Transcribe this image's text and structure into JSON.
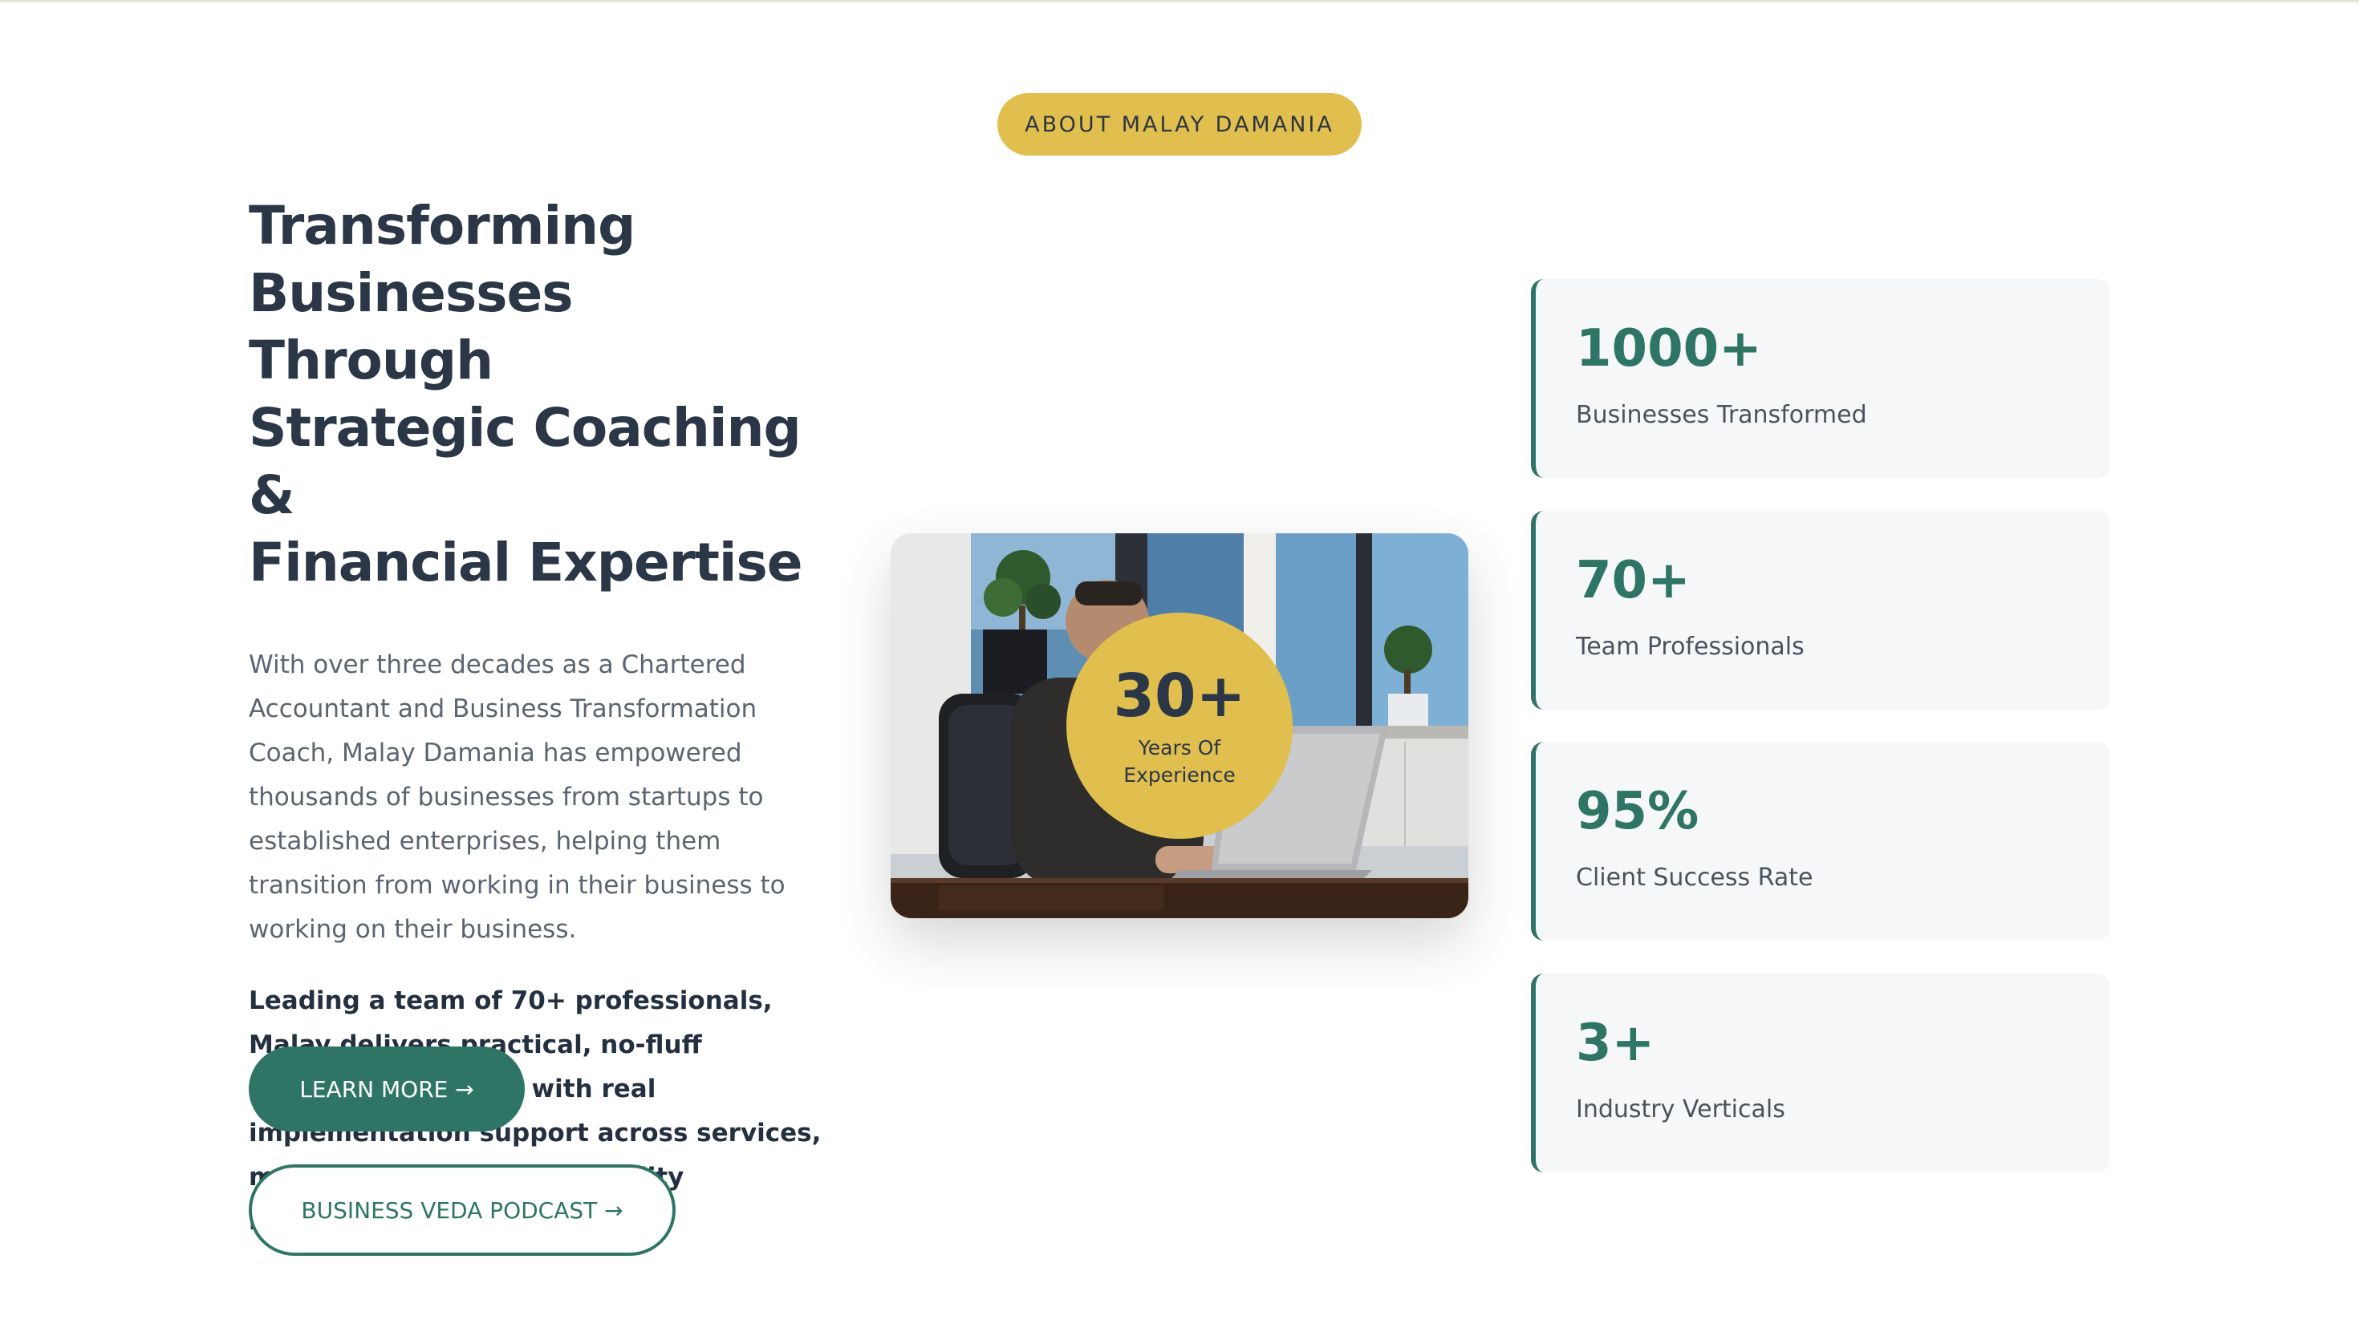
{
  "badge": {
    "label": "ABOUT MALAY DAMANIA"
  },
  "about": {
    "headline_lines": [
      "Transforming",
      "Businesses Through",
      "Strategic Coaching &",
      "Financial Expertise"
    ],
    "paragraph": "With over three decades as a Chartered Accountant and Business Transformation Coach, Malay Damania has empowered thousands of businesses from startups to established enterprises, helping them transition from working in their business to working on their business.",
    "paragraph_strong": "Leading a team of 70+ professionals, Malay delivers practical, no-fluff business strategies with real implementation support across services, manufacturing, and hospitality industries."
  },
  "buttons": {
    "learn_more": "LEARN MORE →",
    "podcast": "BUSINESS VEDA PODCAST →"
  },
  "experience": {
    "number": "30+",
    "label_line1": "Years Of",
    "label_line2": "Experience"
  },
  "stats": [
    {
      "number": "1000+",
      "label": "Businesses Transformed"
    },
    {
      "number": "70+",
      "label": "Team Professionals"
    },
    {
      "number": "95%",
      "label": "Client Success Rate"
    },
    {
      "number": "3+",
      "label": "Industry Verticals"
    }
  ],
  "colors": {
    "brand_green": "#2f7566",
    "accent_gold": "#e0bf4f",
    "heading": "#2b3647",
    "card_bg": "#f6f7f8"
  }
}
